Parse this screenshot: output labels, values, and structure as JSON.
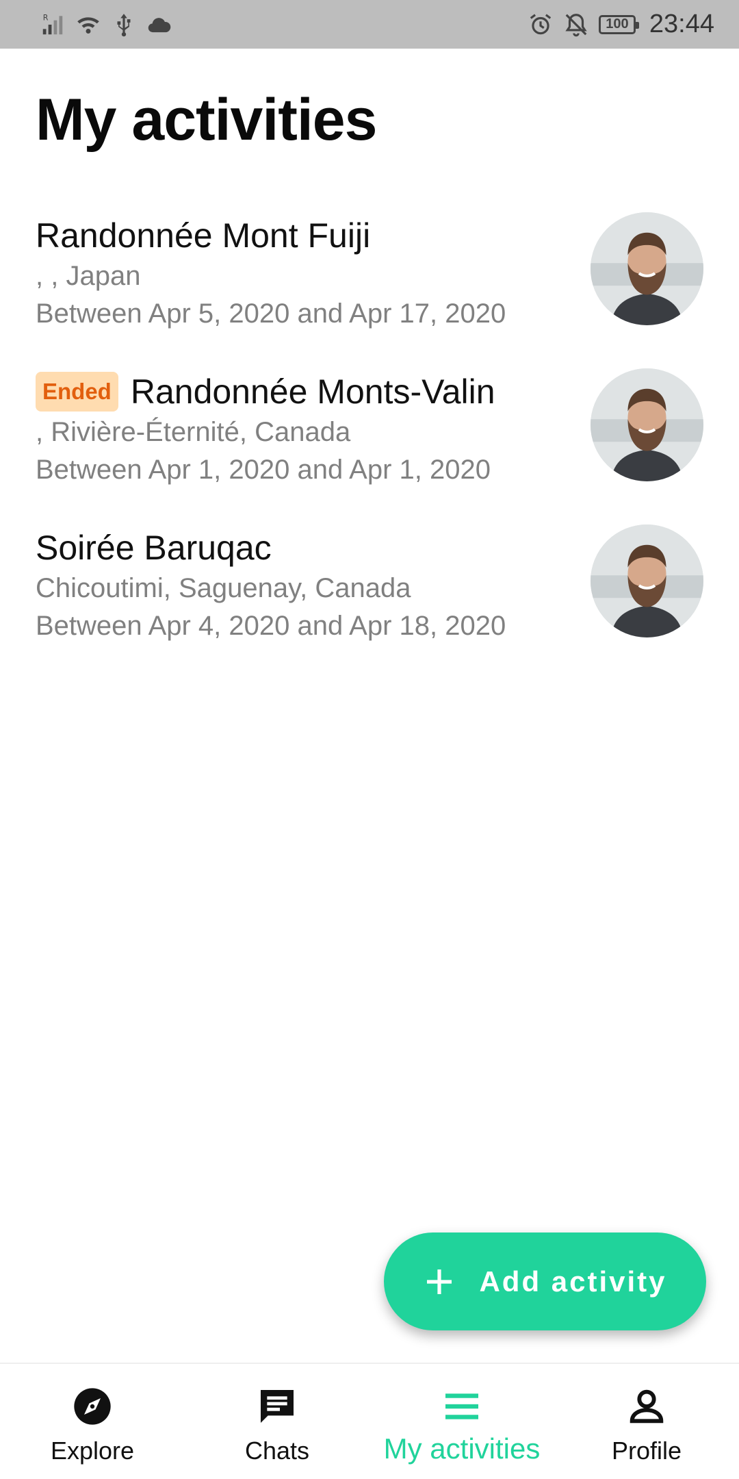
{
  "status_bar": {
    "left_icons": [
      "signal-icon",
      "wifi-icon",
      "usb-icon",
      "cloud-icon"
    ],
    "right_icons": [
      "alarm-icon",
      "notifications-off-icon"
    ],
    "battery": "100",
    "time": "23:44"
  },
  "header": {
    "title": "My activities"
  },
  "activities": [
    {
      "status": "",
      "title": "Randonnée Mont Fuiji",
      "location": ", , Japan",
      "dates": "Between Apr 5, 2020 and Apr 17, 2020"
    },
    {
      "status": "Ended",
      "title": "Randonnée Monts-Valin",
      "location": ", Rivière-Éternité, Canada",
      "dates": "Between Apr 1, 2020 and Apr 1, 2020"
    },
    {
      "status": "",
      "title": "Soirée Baruqac",
      "location": "Chicoutimi, Saguenay, Canada",
      "dates": "Between Apr 4, 2020 and Apr 18, 2020"
    }
  ],
  "fab": {
    "label": "Add activity",
    "icon": "plus-icon"
  },
  "bottom_nav": {
    "items": [
      {
        "label": "Explore",
        "icon": "compass-icon",
        "active": false
      },
      {
        "label": "Chats",
        "icon": "chat-icon",
        "active": false
      },
      {
        "label": "My activities",
        "icon": "menu-icon",
        "active": true
      },
      {
        "label": "Profile",
        "icon": "person-icon",
        "active": false
      }
    ]
  },
  "colors": {
    "accent": "#20d39b",
    "status_bar": "#bdbdbd",
    "ended_tag_bg": "#ffdcb0",
    "ended_tag_text": "#e25f0e",
    "secondary_text": "#808080"
  }
}
